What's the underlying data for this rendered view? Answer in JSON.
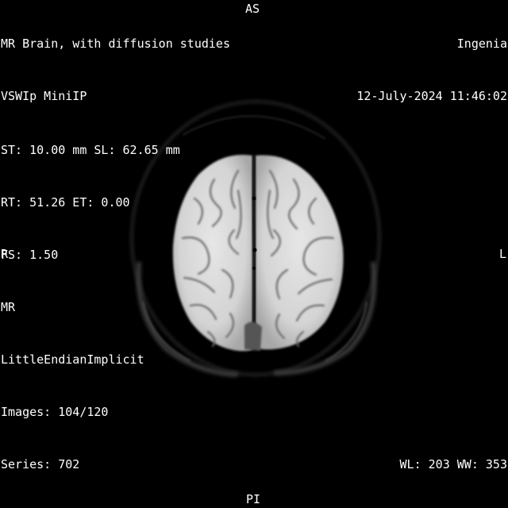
{
  "top_left": {
    "study_description": "MR Brain, with diffusion studies",
    "series_description": "VSWIp MiniIP"
  },
  "top_right": {
    "institution": "Ingenia",
    "date_time": "12-July-2024 11:46:02"
  },
  "orientation": {
    "top": "AS",
    "bottom": "PI",
    "left": "R",
    "right": "L"
  },
  "bottom_left": {
    "slice": "ST: 10.00 mm SL: 62.65 mm",
    "timing": "RT: 51.26 ET: 0.00",
    "field_strength": "FS: 1.50",
    "modality": "MR",
    "transfer_syntax": "LittleEndianImplicit",
    "images": "Images: 104/120",
    "series": "Series: 702"
  },
  "bottom_right": {
    "window": "WL: 203 WW: 353"
  },
  "colors": {
    "background": "#000000",
    "text": "#ffffff",
    "tissue": "#d8d8d8"
  }
}
